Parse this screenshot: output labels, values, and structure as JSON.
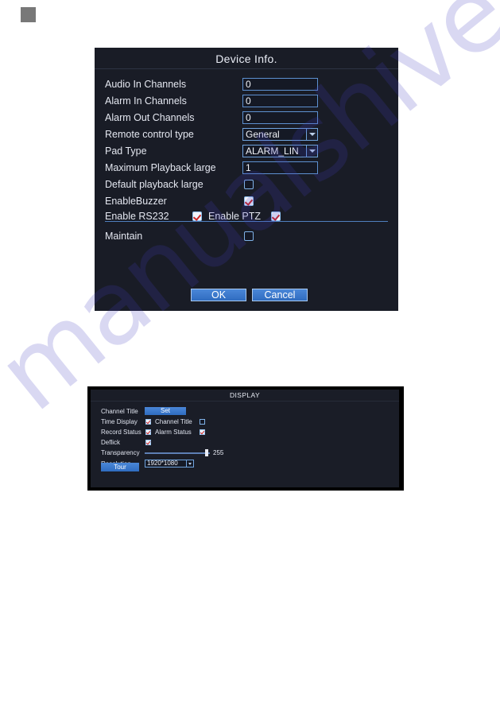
{
  "page": {
    "watermark_text": "manualshive.com",
    "watermark_color": "#403ebe",
    "background": "#ffffff",
    "corner_swatch_color": "#787878"
  },
  "device_info": {
    "title": "Device Info.",
    "rows": [
      {
        "label": "Audio In Channels",
        "type": "text",
        "value": "0"
      },
      {
        "label": "Alarm In Channels",
        "type": "text",
        "value": "0"
      },
      {
        "label": "Alarm Out Channels",
        "type": "text",
        "value": "0"
      },
      {
        "label": "Remote control type",
        "type": "select",
        "value": "General"
      },
      {
        "label": "Pad Type",
        "type": "select",
        "value": "ALARM_LIN"
      },
      {
        "label": "Maximum Playback large",
        "type": "text",
        "value": "1"
      },
      {
        "label": "Default playback large",
        "type": "checkbox",
        "checked": false
      },
      {
        "label": "EnableBuzzer",
        "type": "checkbox",
        "checked": true
      }
    ],
    "inline_row": {
      "label_a": "Enable RS232",
      "checked_a": true,
      "label_b": "Enable PTZ",
      "checked_b": true
    },
    "maintain": {
      "label": "Maintain",
      "checked": false
    },
    "buttons": {
      "ok": "OK",
      "cancel": "Cancel"
    },
    "colors": {
      "dialog_bg": "#191c26",
      "field_border": "#5d90d0",
      "button_blue": "#3a79cc",
      "check_red": "#cc2626"
    }
  },
  "display": {
    "title": "DISPLAY",
    "channel_title": {
      "label": "Channel Title",
      "button": "Set"
    },
    "time_display": {
      "label": "Time Display",
      "checked": true,
      "label2": "Channel Title",
      "checked2": false
    },
    "record_status": {
      "label": "Record Status",
      "checked": true,
      "label2": "Alarm Status",
      "checked2": true
    },
    "deflick": {
      "label": "Deflick",
      "checked": true
    },
    "transparency": {
      "label": "Transparency",
      "value": "255"
    },
    "resolution": {
      "label": "Resolution",
      "value": "1920*1080"
    },
    "tour_button": "Tour",
    "colors": {
      "outer_bg": "#000000",
      "inner_bg": "#1a1d27"
    }
  }
}
